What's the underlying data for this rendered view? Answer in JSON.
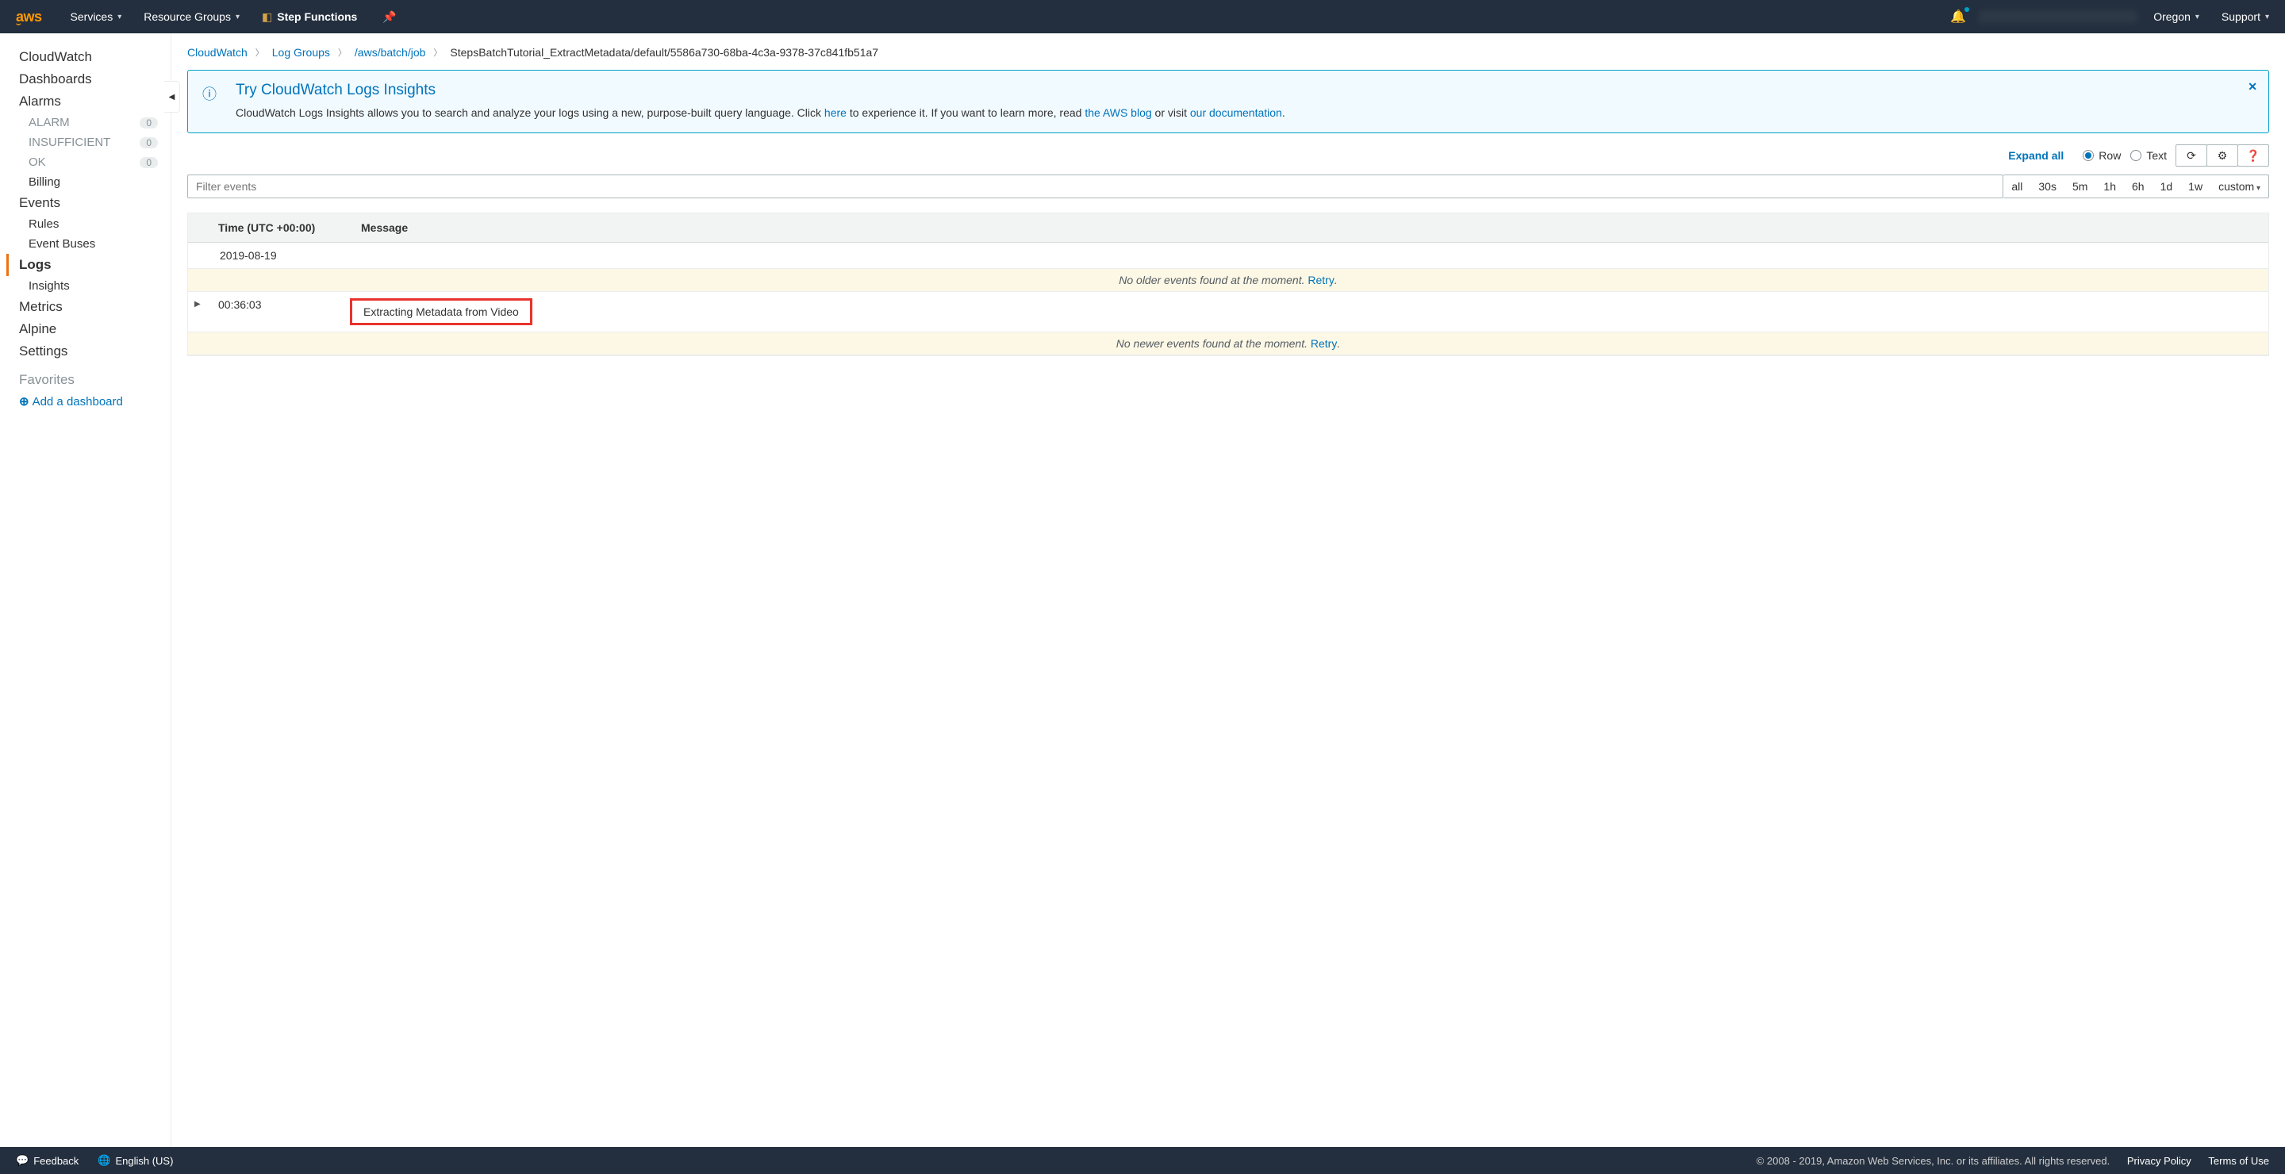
{
  "topnav": {
    "services": "Services",
    "resource_groups": "Resource Groups",
    "step_functions": "Step Functions",
    "region": "Oregon",
    "support": "Support"
  },
  "sidebar": {
    "cloudwatch": "CloudWatch",
    "dashboards": "Dashboards",
    "alarms": "Alarms",
    "alarm_sub": [
      {
        "label": "ALARM",
        "count": "0"
      },
      {
        "label": "INSUFFICIENT",
        "count": "0"
      },
      {
        "label": "OK",
        "count": "0"
      }
    ],
    "billing": "Billing",
    "events": "Events",
    "rules": "Rules",
    "event_buses": "Event Buses",
    "logs": "Logs",
    "insights": "Insights",
    "metrics": "Metrics",
    "alpine": "Alpine",
    "settings": "Settings",
    "favorites": "Favorites",
    "add_dashboard": "Add a dashboard"
  },
  "breadcrumb": {
    "a": "CloudWatch",
    "b": "Log Groups",
    "c": "/aws/batch/job",
    "d": "StepsBatchTutorial_ExtractMetadata/default/5586a730-68ba-4c3a-9378-37c841fb51a7"
  },
  "infobox": {
    "title": "Try CloudWatch Logs Insights",
    "body1": "CloudWatch Logs Insights allows you to search and analyze your logs using a new, purpose-built query language. Click ",
    "link1": "here",
    "body2": " to experience it. If you want to learn more, read ",
    "link2": "the AWS blog",
    "body3": " or visit ",
    "link3": "our documentation",
    "body4": "."
  },
  "controls": {
    "expand": "Expand all",
    "row": "Row",
    "text": "Text"
  },
  "filter": {
    "placeholder": "Filter events",
    "pills": [
      "all",
      "30s",
      "5m",
      "1h",
      "6h",
      "1d",
      "1w"
    ],
    "custom": "custom"
  },
  "table": {
    "col_time": "Time (UTC +00:00)",
    "col_msg": "Message",
    "date": "2019-08-19",
    "older_msg": "No older events found at the moment. ",
    "retry": "Retry",
    "entry_time": "00:36:03",
    "entry_msg": "Extracting Metadata from Video",
    "newer_msg": "No newer events found at the moment. "
  },
  "footer": {
    "feedback": "Feedback",
    "lang": "English (US)",
    "copyright": "© 2008 - 2019, Amazon Web Services, Inc. or its affiliates. All rights reserved.",
    "privacy": "Privacy Policy",
    "terms": "Terms of Use"
  }
}
